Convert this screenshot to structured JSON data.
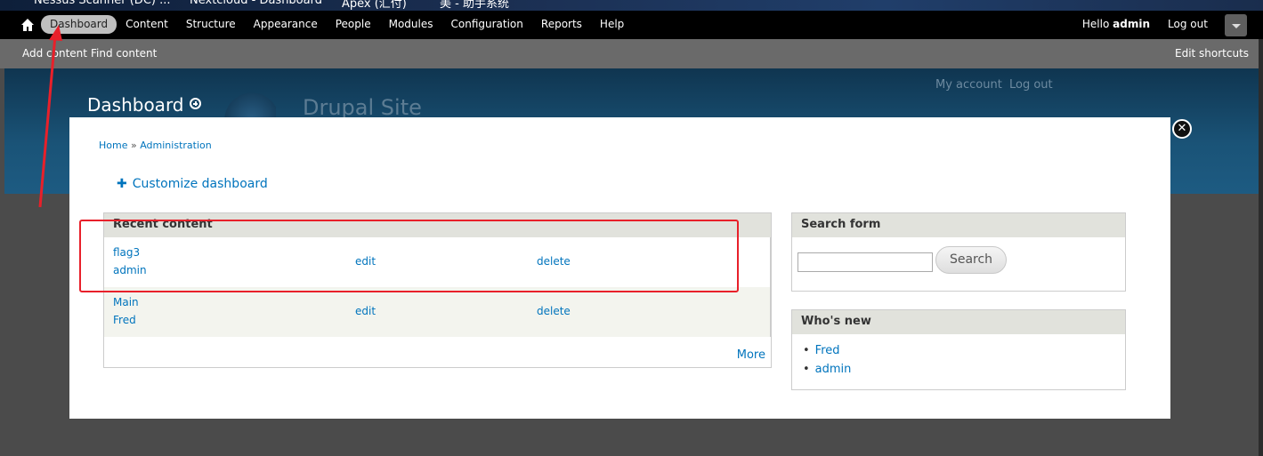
{
  "bookmarks": [
    "Nessus Scanner (DC) ...",
    "Nextcloud - Dashboard",
    "Apex (汇付)",
    "美 - 助手系统"
  ],
  "toolbar": {
    "items": [
      {
        "label": "Dashboard",
        "active": true
      },
      {
        "label": "Content"
      },
      {
        "label": "Structure"
      },
      {
        "label": "Appearance"
      },
      {
        "label": "People"
      },
      {
        "label": "Modules"
      },
      {
        "label": "Configuration"
      },
      {
        "label": "Reports"
      },
      {
        "label": "Help"
      }
    ],
    "hello": "Hello",
    "username": "admin",
    "logout": "Log out"
  },
  "shortcuts": {
    "add_content": "Add content",
    "find_content": "Find content",
    "edit_shortcuts": "Edit shortcuts"
  },
  "site": {
    "name": "Drupal Site",
    "my_account": "My account",
    "log_out": "Log out"
  },
  "overlay": {
    "title": "Dashboard",
    "breadcrumb": {
      "home": "Home",
      "sep": " » ",
      "admin": "Administration"
    },
    "customize": "Customize dashboard"
  },
  "recent_content": {
    "title": "Recent content",
    "rows": [
      {
        "title": "flag3",
        "author": "admin",
        "edit": "edit",
        "delete": "delete"
      },
      {
        "title": "Main",
        "author": "Fred",
        "edit": "edit",
        "delete": "delete"
      }
    ],
    "more": "More"
  },
  "search_form": {
    "title": "Search form",
    "value": "",
    "button": "Search"
  },
  "whos_new": {
    "title": "Who's new",
    "users": [
      "Fred",
      "admin"
    ]
  },
  "annotation_color": "#e8202a"
}
